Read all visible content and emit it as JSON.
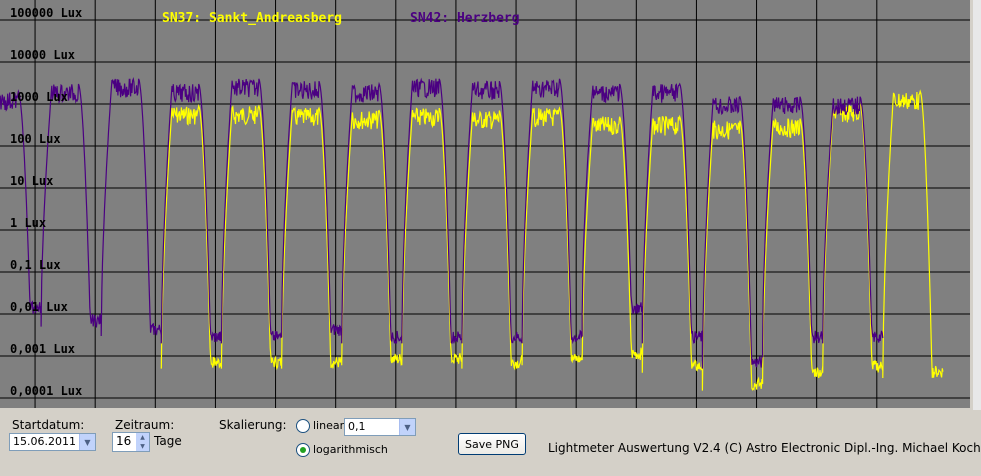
{
  "legend": {
    "series1": "SN37: Sankt_Andreasberg",
    "series2": "SN42: Herzberg"
  },
  "colors": {
    "plot_bg": "#808080",
    "grid": "#000000",
    "series1": "#ffff00",
    "series2": "#4b0082"
  },
  "chart_data": {
    "type": "line",
    "y_scale": "log",
    "ylim": [
      0.0001,
      100000
    ],
    "ytick_labels": [
      "100000 Lux",
      "10000 Lux",
      "1000 Lux",
      "100 Lux",
      "10 Lux",
      "1 Lux",
      "0,1 Lux",
      "0,01 Lux",
      "0,001 Lux",
      "0,0001 Lux"
    ],
    "ytick_values": [
      100000,
      10000,
      1000,
      100,
      10,
      1,
      0.1,
      0.01,
      0.001,
      0.0001
    ],
    "days": 16,
    "series": [
      {
        "name": "SN37: Sankt_Andreasberg",
        "day_max": [
          null,
          null,
          null,
          900,
          900,
          800,
          700,
          800,
          700,
          800,
          500,
          500,
          400,
          450,
          1000,
          2000
        ],
        "night_min": [
          null,
          null,
          null,
          0.0005,
          0.0005,
          0.0005,
          0.0006,
          0.0006,
          0.0005,
          0.0006,
          0.0008,
          0.0004,
          0.00015,
          0.0003,
          0.0004,
          0.0003
        ]
      },
      {
        "name": "SN42: Herzberg",
        "day_max": [
          2000,
          3000,
          4000,
          3000,
          4000,
          3500,
          3000,
          4000,
          3500,
          4000,
          3000,
          3000,
          1500,
          1500,
          1500,
          null
        ],
        "night_min": [
          0.01,
          0.005,
          0.003,
          0.002,
          0.002,
          0.003,
          0.002,
          0.002,
          0.002,
          0.002,
          0.01,
          0.002,
          0.0005,
          0.002,
          0.002,
          null
        ]
      }
    ]
  },
  "controls": {
    "startdatum_label": "Startdatum:",
    "startdatum_value": "15.06.2011",
    "zeitraum_label": "Zeitraum:",
    "zeitraum_value": "16",
    "zeitraum_unit": "Tage",
    "skalierung_label": "Skalierung:",
    "linear_label": "linear",
    "linear_value": "0,1",
    "log_label": "logarithmisch",
    "save_button": "Save PNG",
    "footer_text": "Lightmeter Auswertung V2.4  (C) Astro Electronic Dipl.-Ing. Michael Koch"
  }
}
